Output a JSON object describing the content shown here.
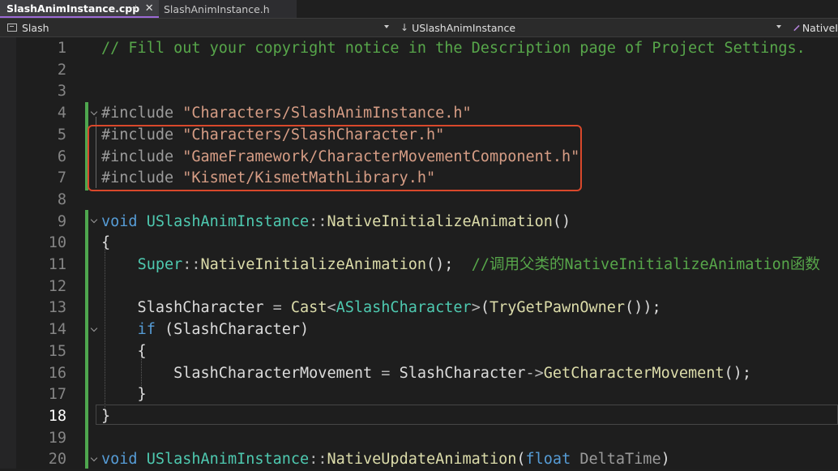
{
  "tabs": [
    {
      "label": "SlashAnimInstance.cpp",
      "active": true
    },
    {
      "label": "SlashAnimInstance.h",
      "active": false
    }
  ],
  "navbar": {
    "project": "Slash",
    "scope": "USlashAnimInstance",
    "member": "NativeI"
  },
  "editor": {
    "current_line": 18,
    "line_numbers": [
      "1",
      "2",
      "3",
      "4",
      "5",
      "6",
      "7",
      "8",
      "9",
      "10",
      "11",
      "12",
      "13",
      "14",
      "15",
      "16",
      "17",
      "18",
      "19",
      "20"
    ],
    "lines": [
      {
        "segments": [
          {
            "c": "c-comment",
            "t": "// Fill out your copyright notice in the Description page of Project Settings."
          }
        ]
      },
      {
        "segments": []
      },
      {
        "segments": []
      },
      {
        "segments": [
          {
            "c": "c-pre",
            "t": "#include "
          },
          {
            "c": "c-str",
            "t": "\"Characters/SlashAnimInstance.h\""
          }
        ]
      },
      {
        "segments": [
          {
            "c": "c-pre",
            "t": "#include "
          },
          {
            "c": "c-str",
            "t": "\"Characters/SlashCharacter.h\""
          }
        ]
      },
      {
        "segments": [
          {
            "c": "c-pre",
            "t": "#include "
          },
          {
            "c": "c-str",
            "t": "\"GameFramework/CharacterMovementComponent.h\""
          }
        ]
      },
      {
        "segments": [
          {
            "c": "c-pre",
            "t": "#include "
          },
          {
            "c": "c-str",
            "t": "\"Kismet/KismetMathLibrary.h\""
          }
        ]
      },
      {
        "segments": []
      },
      {
        "segments": [
          {
            "c": "c-kw",
            "t": "void "
          },
          {
            "c": "c-type",
            "t": "USlashAnimInstance"
          },
          {
            "c": "c-op",
            "t": "::"
          },
          {
            "c": "c-fn",
            "t": "NativeInitializeAnimation"
          },
          {
            "c": "c-plain",
            "t": "()"
          }
        ]
      },
      {
        "segments": [
          {
            "c": "c-plain",
            "t": "{"
          }
        ]
      },
      {
        "segments": [
          {
            "c": "c-plain",
            "t": "    "
          },
          {
            "c": "c-type",
            "t": "Super"
          },
          {
            "c": "c-op",
            "t": "::"
          },
          {
            "c": "c-fn",
            "t": "NativeInitializeAnimation"
          },
          {
            "c": "c-plain",
            "t": "();  "
          },
          {
            "c": "c-comment",
            "t": "//调用父类的NativeInitializeAnimation函数"
          }
        ]
      },
      {
        "segments": []
      },
      {
        "segments": [
          {
            "c": "c-plain",
            "t": "    SlashCharacter "
          },
          {
            "c": "c-op",
            "t": "= "
          },
          {
            "c": "c-fn",
            "t": "Cast"
          },
          {
            "c": "c-op",
            "t": "<"
          },
          {
            "c": "c-type",
            "t": "ASlashCharacter"
          },
          {
            "c": "c-op",
            "t": ">"
          },
          {
            "c": "c-plain",
            "t": "("
          },
          {
            "c": "c-fn",
            "t": "TryGetPawnOwner"
          },
          {
            "c": "c-plain",
            "t": "());"
          }
        ]
      },
      {
        "segments": [
          {
            "c": "c-plain",
            "t": "    "
          },
          {
            "c": "c-kw",
            "t": "if"
          },
          {
            "c": "c-plain",
            "t": " (SlashCharacter)"
          }
        ]
      },
      {
        "segments": [
          {
            "c": "c-plain",
            "t": "    {"
          }
        ]
      },
      {
        "segments": [
          {
            "c": "c-plain",
            "t": "        SlashCharacterMovement "
          },
          {
            "c": "c-op",
            "t": "= "
          },
          {
            "c": "c-plain",
            "t": "SlashCharacter"
          },
          {
            "c": "c-op",
            "t": "->"
          },
          {
            "c": "c-fn",
            "t": "GetCharacterMovement"
          },
          {
            "c": "c-plain",
            "t": "();"
          }
        ]
      },
      {
        "segments": [
          {
            "c": "c-plain",
            "t": "    }"
          }
        ]
      },
      {
        "segments": [
          {
            "c": "c-plain",
            "t": "}"
          }
        ]
      },
      {
        "segments": []
      },
      {
        "segments": [
          {
            "c": "c-kw",
            "t": "void "
          },
          {
            "c": "c-type",
            "t": "USlashAnimInstance"
          },
          {
            "c": "c-op",
            "t": "::"
          },
          {
            "c": "c-fn",
            "t": "NativeUpdateAnimation"
          },
          {
            "c": "c-plain",
            "t": "("
          },
          {
            "c": "c-kw",
            "t": "float "
          },
          {
            "c": "c-param",
            "t": "DeltaTime"
          },
          {
            "c": "c-plain",
            "t": ")"
          }
        ]
      }
    ]
  }
}
